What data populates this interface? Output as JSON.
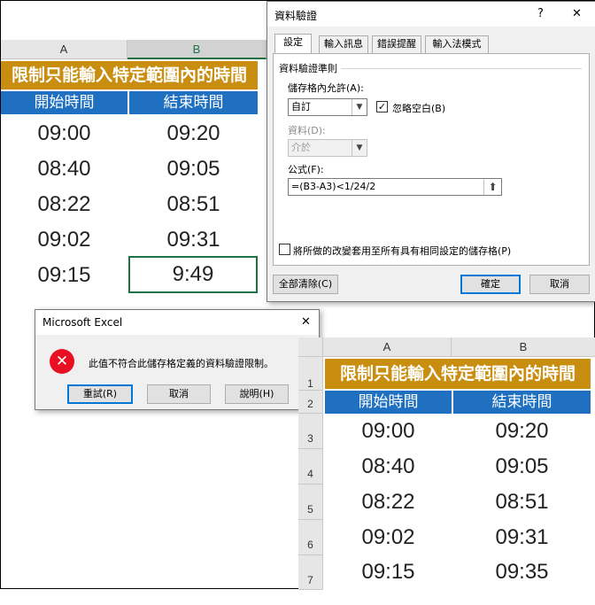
{
  "sheet_top": {
    "col_headers": [
      "A",
      "B"
    ],
    "title": "限制只能輸入特定範圍內的時間",
    "headers": [
      "開始時間",
      "結束時間"
    ],
    "rows": [
      [
        "09:00",
        "09:20"
      ],
      [
        "08:40",
        "09:05"
      ],
      [
        "08:22",
        "08:51"
      ],
      [
        "09:02",
        "09:31"
      ],
      [
        "09:15",
        "9:49"
      ]
    ]
  },
  "sheet_bottom": {
    "col_headers": [
      "A",
      "B"
    ],
    "row_numbers": [
      "1",
      "2",
      "3",
      "4",
      "5",
      "6",
      "7"
    ],
    "title": "限制只能輸入特定範圍內的時間",
    "headers": [
      "開始時間",
      "結束時間"
    ],
    "rows": [
      [
        "09:00",
        "09:20"
      ],
      [
        "08:40",
        "09:05"
      ],
      [
        "08:22",
        "08:51"
      ],
      [
        "09:02",
        "09:31"
      ],
      [
        "09:15",
        "09:35"
      ]
    ]
  },
  "validation_dialog": {
    "title": "資料驗證",
    "help": "?",
    "close": "✕",
    "tabs": [
      "設定",
      "輸入訊息",
      "錯誤提醒",
      "輸入法模式"
    ],
    "section_label": "資料驗證準則",
    "allow_label": "儲存格內允許(A):",
    "allow_value": "自訂",
    "ignore_blank_label": "忽略空白(B)",
    "ignore_blank_checked": "✓",
    "data_label": "資料(D):",
    "data_value": "介於",
    "formula_label": "公式(F):",
    "formula_value": "=(B3-A3)<1/24/2",
    "apply_all_label": "將所做的改變套用至所有具有相同設定的儲存格(P)",
    "clear_all_button": "全部清除(C)",
    "ok_button": "確定",
    "cancel_button": "取消"
  },
  "error_dialog": {
    "title": "Microsoft Excel",
    "close": "✕",
    "message": "此值不符合此儲存格定義的資料驗證限制。",
    "retry_button": "重試(R)",
    "cancel_button": "取消",
    "help_button": "說明(H)",
    "error_icon": "error-circle-x-icon"
  },
  "colors": {
    "title_bg": "#c98e0f",
    "header_bg": "#1f70c1",
    "selection": "#217346",
    "error_red": "#e81123"
  }
}
